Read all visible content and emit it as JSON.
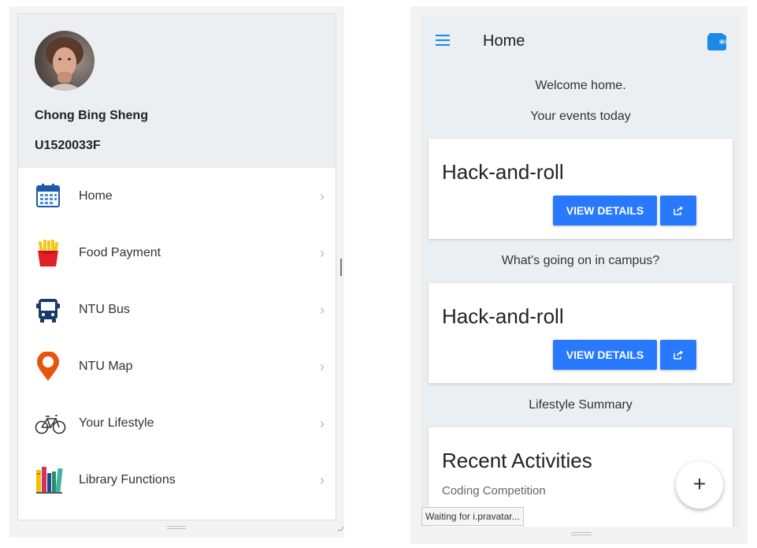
{
  "drawer": {
    "user_name": "Chong Bing Sheng",
    "user_id": "U1520033F",
    "items": [
      {
        "label": "Home",
        "icon": "calendar-icon"
      },
      {
        "label": "Food Payment",
        "icon": "fries-icon"
      },
      {
        "label": "NTU Bus",
        "icon": "bus-icon"
      },
      {
        "label": "NTU Map",
        "icon": "map-pin-icon"
      },
      {
        "label": "Your Lifestyle",
        "icon": "bicycle-icon"
      },
      {
        "label": "Library Functions",
        "icon": "books-icon"
      }
    ]
  },
  "home": {
    "title": "Home",
    "welcome": "Welcome home.",
    "events_heading": "Your events today",
    "event_card": {
      "title": "Hack-and-roll",
      "button": "VIEW DETAILS"
    },
    "campus_heading": "What's going on in campus?",
    "campus_card": {
      "title": "Hack-and-roll",
      "button": "VIEW DETAILS"
    },
    "lifestyle_heading": "Lifestyle Summary",
    "recent": {
      "title": "Recent Activities",
      "item": "Coding Competition"
    },
    "fab_label": "+",
    "status_text": "Waiting for i.pravatar..."
  },
  "colors": {
    "accent": "#2979ff",
    "header_bg": "#eceff1",
    "map_pin": "#e8540c",
    "bus_blue": "#1a3a6e"
  }
}
